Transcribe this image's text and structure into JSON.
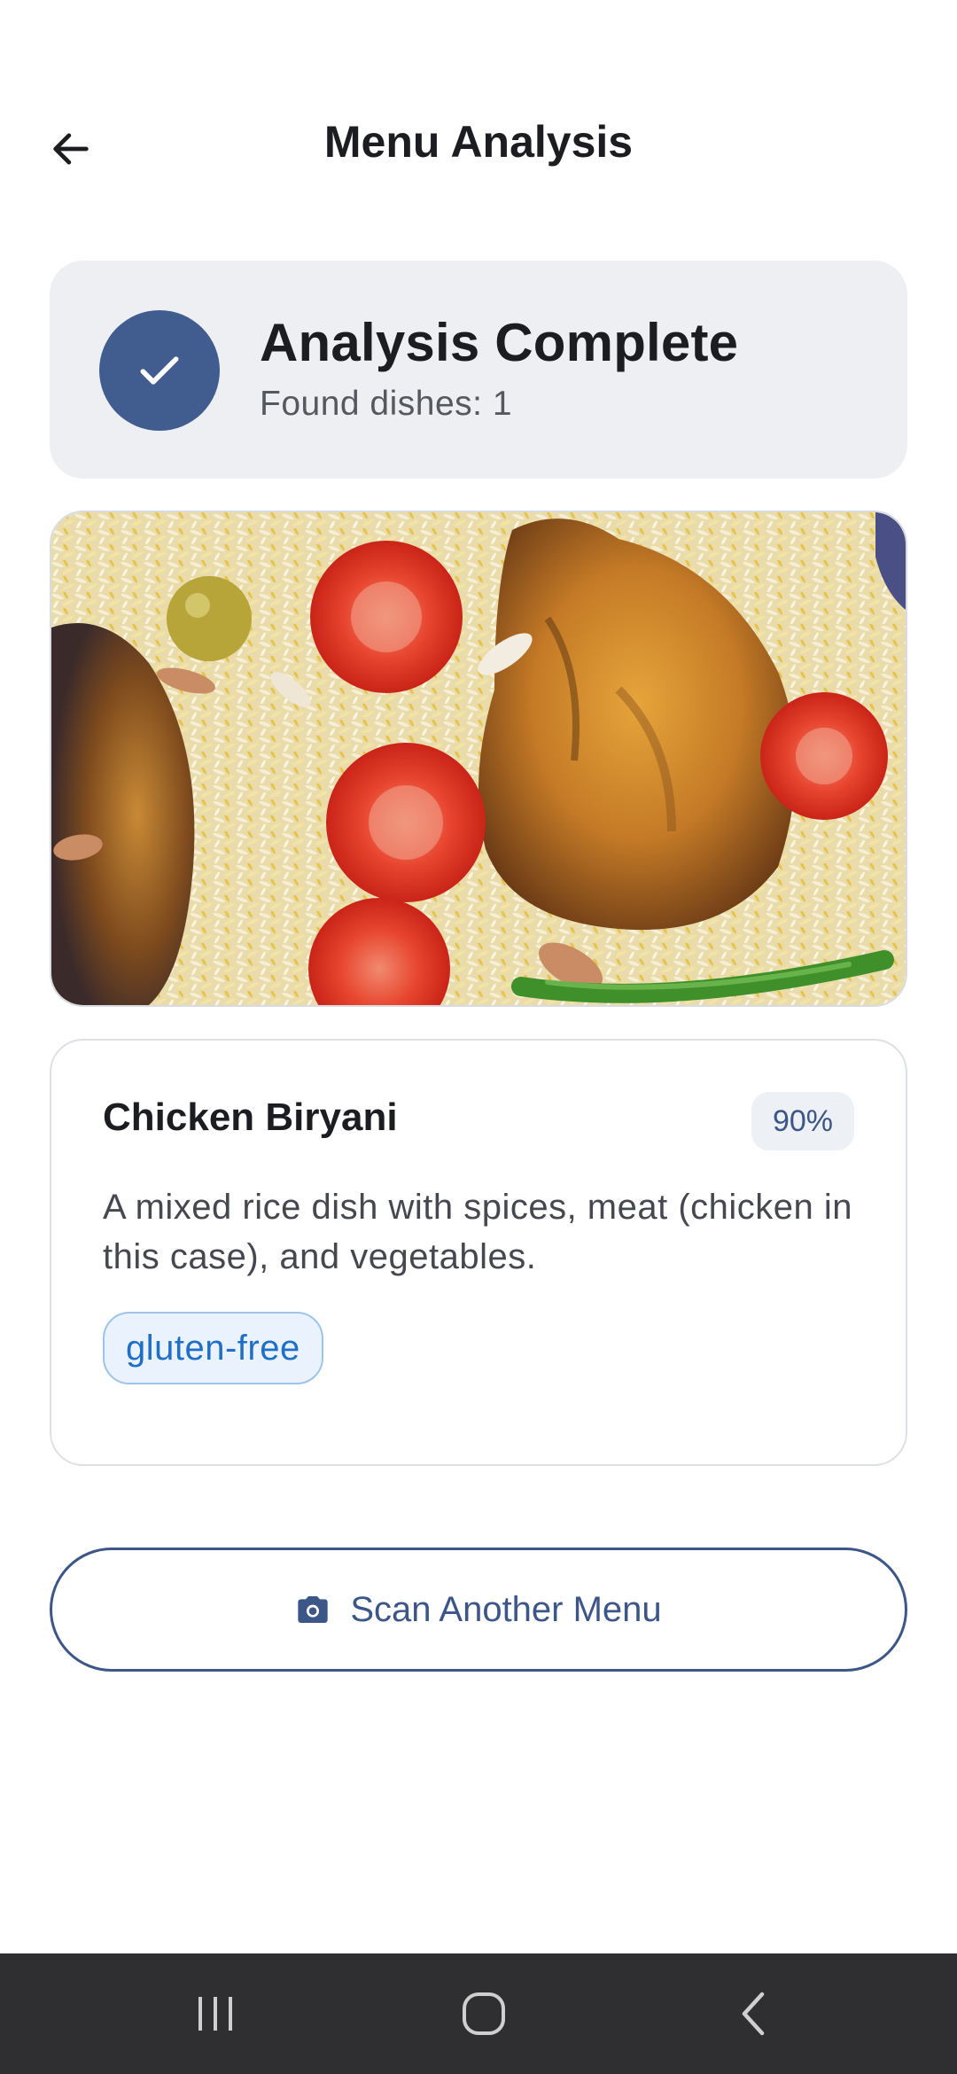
{
  "header": {
    "title": "Menu Analysis",
    "back_icon": "arrow-left-icon"
  },
  "status": {
    "title": "Analysis Complete",
    "subtitle": "Found dishes: 1",
    "icon": "check-icon",
    "accent_color": "#415c8f"
  },
  "dish": {
    "image": "chicken-biryani-photo",
    "name": "Chicken Biryani",
    "confidence": "90%",
    "description": "A mixed rice dish with spices, meat (chicken in this case), and vegetables.",
    "tags": [
      "gluten-free"
    ]
  },
  "actions": {
    "scan_label": "Scan Another Menu",
    "scan_icon": "camera-icon"
  },
  "system_nav": {
    "recents_icon": "recents-icon",
    "home_icon": "home-icon",
    "back_icon": "nav-back-icon"
  }
}
